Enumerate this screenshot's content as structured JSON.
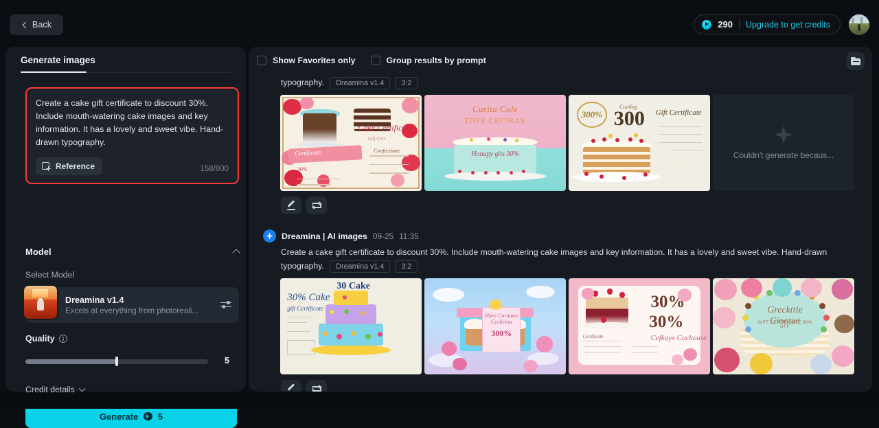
{
  "header": {
    "back_label": "Back",
    "credits_value": "290",
    "upgrade_label": "Upgrade to get credits",
    "coin_icon": "credit-coin-icon",
    "avatar_icon": "user-avatar"
  },
  "left_panel": {
    "tab_label": "Generate images",
    "prompt": {
      "text": "Create a cake gift certificate to discount 30%. Include mouth-watering cake images and key information. It has a lovely and sweet vibe. Hand-drawn typography.",
      "reference_label": "Reference",
      "reference_icon": "add-image-icon",
      "char_count": "158/800"
    },
    "model_section": {
      "title": "Model",
      "collapse_icon": "chevron-up-icon",
      "select_label": "Select Model",
      "model_name": "Dreamina v1.4",
      "model_desc": "Excels at everything from photoreali...",
      "settings_icon": "sliders-icon"
    },
    "quality": {
      "label": "Quality",
      "info_icon": "info-icon",
      "value": "5",
      "fill_percent": 50
    },
    "credit_details": {
      "label": "Credit details",
      "expand_icon": "chevron-down-icon"
    },
    "generate": {
      "label": "Generate",
      "cost": "5",
      "coin_icon": "credit-coin-icon",
      "accent_color": "#0ad2e8"
    }
  },
  "results": {
    "toolbar": {
      "favorites_label": "Show Favorites only",
      "favorites_checked": false,
      "group_label": "Group results by prompt",
      "group_checked": false,
      "folder_icon": "folder-icon"
    },
    "groups": [
      {
        "partial": true,
        "prompt_tail": "typography.",
        "chips": [
          "Dreamina v1.4",
          "3:2"
        ],
        "thumbs": [
          {
            "name": "floral-certificate",
            "error": false
          },
          {
            "name": "pink-cake-certificate",
            "error": false
          },
          {
            "name": "cream-layer-cake-30",
            "error": false
          },
          {
            "name": "generation-error",
            "error": true,
            "error_text": "Couldn't generate becaus..."
          }
        ],
        "actions": [
          {
            "name": "edit-button",
            "icon": "pencil-icon"
          },
          {
            "name": "regenerate-button",
            "icon": "loop-icon"
          }
        ]
      },
      {
        "partial": false,
        "badge_icon": "dreamina-sparkle-icon",
        "title": "Dreamina | AI images",
        "date": "09-25",
        "time": "11:35",
        "prompt": "Create a cake gift certificate to discount 30%. Include mouth-watering cake images and key information. It has a lovely and sweet vibe. Hand-drawn typography.",
        "chips": [
          "Dreamina v1.4",
          "3:2"
        ],
        "thumbs": [
          {
            "name": "blue-tiered-cake-certificate",
            "error": false
          },
          {
            "name": "3d-gift-box-cupcakes",
            "error": false
          },
          {
            "name": "pink-strawberry-30-percent",
            "error": false
          },
          {
            "name": "rose-decorated-cake",
            "error": false
          }
        ],
        "actions": [
          {
            "name": "edit-button",
            "icon": "pencil-icon"
          },
          {
            "name": "regenerate-button",
            "icon": "loop-icon"
          }
        ]
      }
    ]
  },
  "art_text": {
    "cert_a_ribbon": "Certificate",
    "cert_a_script": "Cake Certificate",
    "cert_a_sub": "Gift Cert",
    "cert_a_small": "Confectione",
    "cert_a_pct": "30%",
    "pink_hd": "Curita Cale",
    "pink_hd2": "TIIFE CECIRAE",
    "pink_hd3": "OF GIFT SKY",
    "pink_txt": "Honapy gits 30%",
    "cream_seal": "300%",
    "cream_big": "300",
    "cream_sub": "Cooling",
    "cream_gift": "Gift Certificate",
    "blue_topper": "30 Cake",
    "blue_hl": "30% Cake",
    "blue_hl2": "gift Certificate",
    "gift_card_t": "Have Carnatse Cecliciou",
    "gift_card_n": "300%",
    "pink_cert_30a": "30%",
    "pink_cert_30b": "30%",
    "pink_cert_scr": "Cefkaye Cochouse",
    "pink_cert_lbl": "Certificate",
    "rose_scr": "Greckttie Ciootue",
    "rose_scr2": "GIFT CERTIFICATE 30% OFF"
  }
}
